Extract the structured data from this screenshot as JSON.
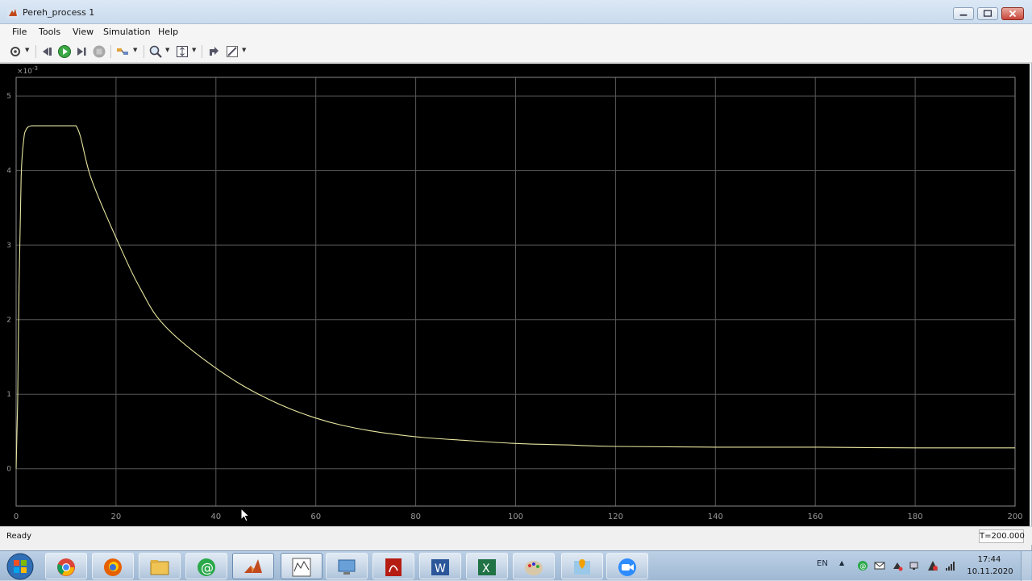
{
  "window": {
    "title": "Pereh_process 1",
    "menu": [
      "File",
      "Tools",
      "View",
      "Simulation",
      "Help"
    ],
    "toolbar_icons": [
      "parameters-icon",
      "step-back-icon",
      "run-icon",
      "step-forward-icon",
      "stop-icon",
      "highlight-icon",
      "zoom-icon",
      "autoscale-icon",
      "restore-icon",
      "cursor-measure-icon"
    ]
  },
  "scope": {
    "background": "#000000",
    "grid_color": "#595959",
    "line_color": "#e8e6a0",
    "tick_color": "#9a9a9a",
    "exponent_label": "×10",
    "exponent_power": "-3",
    "x_ticks": [
      "0",
      "20",
      "40",
      "60",
      "80",
      "100",
      "120",
      "140",
      "160",
      "180",
      "200"
    ],
    "y_ticks": [
      "0",
      "1",
      "2",
      "3",
      "4",
      "5"
    ]
  },
  "chart_data": {
    "type": "line",
    "xlim": [
      0,
      200
    ],
    "ylim": [
      -0.5,
      5.25
    ],
    "y_scale_factor": "1e-3",
    "grid": true,
    "series": [
      {
        "x": [
          0,
          0.3,
          0.6,
          1,
          1.5,
          2,
          3,
          5,
          8,
          12,
          15,
          20,
          25,
          30,
          40,
          50,
          60,
          70,
          80,
          90,
          100,
          110,
          120,
          140,
          160,
          180,
          200
        ],
        "values": [
          0,
          0.9,
          2.5,
          3.9,
          4.4,
          4.55,
          4.6,
          4.6,
          4.6,
          4.6,
          3.9,
          3.1,
          2.4,
          1.9,
          1.35,
          0.95,
          0.68,
          0.52,
          0.43,
          0.38,
          0.34,
          0.32,
          0.3,
          0.29,
          0.29,
          0.28,
          0.28
        ]
      }
    ]
  },
  "status": {
    "text": "Ready",
    "time": "T=200.000"
  },
  "taskbar": {
    "apps": [
      "chrome-icon",
      "firefox-icon",
      "file-explorer-icon",
      "mail-agent-icon",
      "matlab-icon",
      "scope-figure-icon",
      "remote-desktop-icon",
      "pdf-reader-icon",
      "word-icon",
      "excel-icon",
      "paint-icon",
      "maps-icon",
      "zoom-video-icon"
    ],
    "language": "EN",
    "clock_time": "17:44",
    "clock_date": "10.11.2020"
  }
}
